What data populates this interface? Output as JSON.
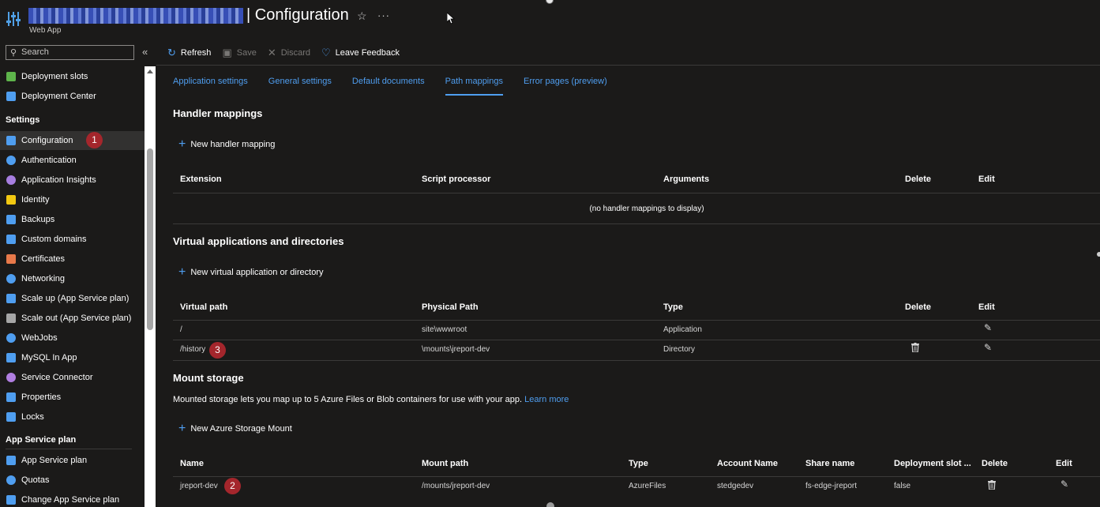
{
  "header": {
    "title": "| Configuration",
    "subtitle": "Web App"
  },
  "search": {
    "placeholder": "Search"
  },
  "nav": {
    "items_top": [
      {
        "label": "Deployment slots",
        "color": "#5eb44b"
      },
      {
        "label": "Deployment Center",
        "color": "#4f9ef0"
      }
    ],
    "settings_header": "Settings",
    "settings_items": [
      {
        "label": "Configuration",
        "color": "#4f9ef0",
        "active": true
      },
      {
        "label": "Authentication",
        "color": "#4f9ef0"
      },
      {
        "label": "Application Insights",
        "color": "#a77ee0"
      },
      {
        "label": "Identity",
        "color": "#f2c811"
      },
      {
        "label": "Backups",
        "color": "#4f9ef0"
      },
      {
        "label": "Custom domains",
        "color": "#4f9ef0"
      },
      {
        "label": "Certificates",
        "color": "#e8794a"
      },
      {
        "label": "Networking",
        "color": "#4f9ef0"
      },
      {
        "label": "Scale up (App Service plan)",
        "color": "#4f9ef0"
      },
      {
        "label": "Scale out (App Service plan)",
        "color": "#a6a6a6"
      },
      {
        "label": "WebJobs",
        "color": "#4f9ef0"
      },
      {
        "label": "MySQL In App",
        "color": "#4f9ef0"
      },
      {
        "label": "Service Connector",
        "color": "#b07ee0"
      },
      {
        "label": "Properties",
        "color": "#4f9ef0"
      },
      {
        "label": "Locks",
        "color": "#4f9ef0"
      }
    ],
    "plan_header": "App Service plan",
    "plan_items": [
      {
        "label": "App Service plan",
        "color": "#4f9ef0"
      },
      {
        "label": "Quotas",
        "color": "#4f9ef0"
      },
      {
        "label": "Change App Service plan",
        "color": "#4f9ef0"
      }
    ]
  },
  "badges": {
    "one": "1",
    "two": "2",
    "three": "3"
  },
  "toolbar": {
    "refresh": "Refresh",
    "save": "Save",
    "discard": "Discard",
    "feedback": "Leave Feedback"
  },
  "tabs": [
    "Application settings",
    "General settings",
    "Default documents",
    "Path mappings",
    "Error pages (preview)"
  ],
  "handler": {
    "title": "Handler mappings",
    "add": "New handler mapping",
    "columns": [
      "Extension",
      "Script processor",
      "Arguments",
      "Delete",
      "Edit"
    ],
    "empty": "(no handler mappings to display)"
  },
  "virtual": {
    "title": "Virtual applications and directories",
    "add": "New virtual application or directory",
    "columns": [
      "Virtual path",
      "Physical Path",
      "Type",
      "Delete",
      "Edit"
    ],
    "rows": [
      {
        "path": "/",
        "physical": "site\\wwwroot",
        "type": "Application"
      },
      {
        "path": "/history",
        "physical": "\\mounts\\jreport-dev",
        "type": "Directory"
      }
    ]
  },
  "mount": {
    "title": "Mount storage",
    "description": "Mounted storage lets you map up to 5 Azure Files or Blob containers for use with your app.",
    "learn_more": "Learn more",
    "add": "New Azure Storage Mount",
    "columns": [
      "Name",
      "Mount path",
      "Type",
      "Account Name",
      "Share name",
      "Deployment slot ...",
      "Delete",
      "Edit"
    ],
    "rows": [
      {
        "name": "jreport-dev",
        "mount_path": "/mounts/jreport-dev",
        "type": "AzureFiles",
        "account": "stedgedev",
        "share": "fs-edge-jreport",
        "slot": "false"
      }
    ]
  }
}
